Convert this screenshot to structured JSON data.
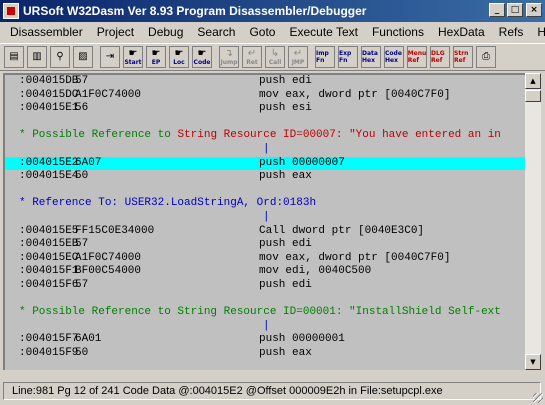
{
  "window": {
    "title": "URSoft W32Dasm Ver 8.93 Program Disassembler/Debugger",
    "app_icon": "w32dasm-icon",
    "controls": {
      "minimize": "_",
      "maximize": "□",
      "close": "×"
    }
  },
  "menu": [
    "Disassembler",
    "Project",
    "Debug",
    "Search",
    "Goto",
    "Execute Text",
    "Functions",
    "HexData",
    "Refs",
    "Help"
  ],
  "toolbar": [
    {
      "icon": "open-file-icon",
      "glyph": "▤",
      "label": ""
    },
    {
      "icon": "save-file-icon",
      "glyph": "▥",
      "label": ""
    },
    {
      "icon": "find-text-icon",
      "glyph": "⚲",
      "label": ""
    },
    {
      "icon": "copy-lines-icon",
      "glyph": "▨",
      "label": ""
    },
    {
      "icon": "goto-entry-icon",
      "glyph": "⇥",
      "label": ""
    },
    {
      "icon": "start-icon",
      "glyph": "☛",
      "label": "Start"
    },
    {
      "icon": "goto-ep-icon",
      "glyph": "☛",
      "label": "EP"
    },
    {
      "icon": "goto-loc-icon",
      "glyph": "☛",
      "label": "Loc"
    },
    {
      "icon": "goto-code-icon",
      "glyph": "☛",
      "label": "Code"
    },
    {
      "icon": "jump-to-icon",
      "glyph": "↴",
      "label": "Jump"
    },
    {
      "icon": "return-icon",
      "glyph": "↵",
      "label": "Ret"
    },
    {
      "icon": "call-icon",
      "glyph": "↳",
      "label": "Call"
    },
    {
      "icon": "return-jump-icon",
      "glyph": "↵",
      "label": "JMP"
    },
    {
      "icon": "imp-fn-icon",
      "glyph": "",
      "label": "Imp Fn"
    },
    {
      "icon": "exp-fn-icon",
      "glyph": "",
      "label": "Exp Fn"
    },
    {
      "icon": "data-hex-icon",
      "glyph": "",
      "label": "Data Hex"
    },
    {
      "icon": "code-hex-icon",
      "glyph": "",
      "label": "Code Hex"
    },
    {
      "icon": "menu-ref-icon",
      "glyph": "",
      "label": "Menu Ref"
    },
    {
      "icon": "dlg-ref-icon",
      "glyph": "",
      "label": "DLG Ref"
    },
    {
      "icon": "strn-ref-icon",
      "glyph": "",
      "label": "Strn Ref"
    },
    {
      "icon": "print-icon",
      "glyph": "⎙",
      "label": ""
    }
  ],
  "listing": [
    {
      "kind": "code",
      "addr": ":004015DB",
      "bytes": "57",
      "instr": "push edi"
    },
    {
      "kind": "code",
      "addr": ":004015DC",
      "bytes": "A1F0C74000",
      "instr": "mov eax, dword ptr [0040C7F0]"
    },
    {
      "kind": "code",
      "addr": ":004015E1",
      "bytes": "56",
      "instr": "push esi"
    },
    {
      "kind": "blank"
    },
    {
      "kind": "sref",
      "prefix": "* Possible Reference to ",
      "text": "String Resource ID=00007: \"You have entered an in"
    },
    {
      "kind": "pipe",
      "text": "|"
    },
    {
      "kind": "code",
      "addr": ":004015E2",
      "bytes": "6A07",
      "instr": "push 00000007",
      "highlight": true
    },
    {
      "kind": "code",
      "addr": ":004015E4",
      "bytes": "50",
      "instr": "push eax"
    },
    {
      "kind": "blank"
    },
    {
      "kind": "bref",
      "text": "* Reference To: USER32.LoadStringA, Ord:0183h"
    },
    {
      "kind": "pipe",
      "text": "|"
    },
    {
      "kind": "code",
      "addr": ":004015E5",
      "bytes": "FF15C0E34000",
      "instr": "Call dword ptr [0040E3C0]"
    },
    {
      "kind": "code",
      "addr": ":004015EB",
      "bytes": "57",
      "instr": "push edi"
    },
    {
      "kind": "code",
      "addr": ":004015EC",
      "bytes": "A1F0C74000",
      "instr": "mov eax, dword ptr [0040C7F0]"
    },
    {
      "kind": "code",
      "addr": ":004015F1",
      "bytes": "BF00C54000",
      "instr": "mov edi, 0040C500"
    },
    {
      "kind": "code",
      "addr": ":004015F6",
      "bytes": "57",
      "instr": "push edi"
    },
    {
      "kind": "blank"
    },
    {
      "kind": "gref",
      "text": "* Possible Reference to String Resource ID=00001: \"InstallShield Self-ext"
    },
    {
      "kind": "pipe",
      "text": "|"
    },
    {
      "kind": "code",
      "addr": ":004015F7",
      "bytes": "6A01",
      "instr": "push 00000001"
    },
    {
      "kind": "code",
      "addr": ":004015F9",
      "bytes": "50",
      "instr": "push eax"
    }
  ],
  "status": {
    "text": "Line:981 Pg 12 of 241  Code Data @:004015E2 @Offset 000009E2h in File:setupcpl.exe"
  },
  "colors": {
    "highlight": "#00ffff",
    "comment_green": "#008000",
    "comment_blue": "#0000c0",
    "string_red": "#c00000",
    "title_start": "#0a246a"
  }
}
